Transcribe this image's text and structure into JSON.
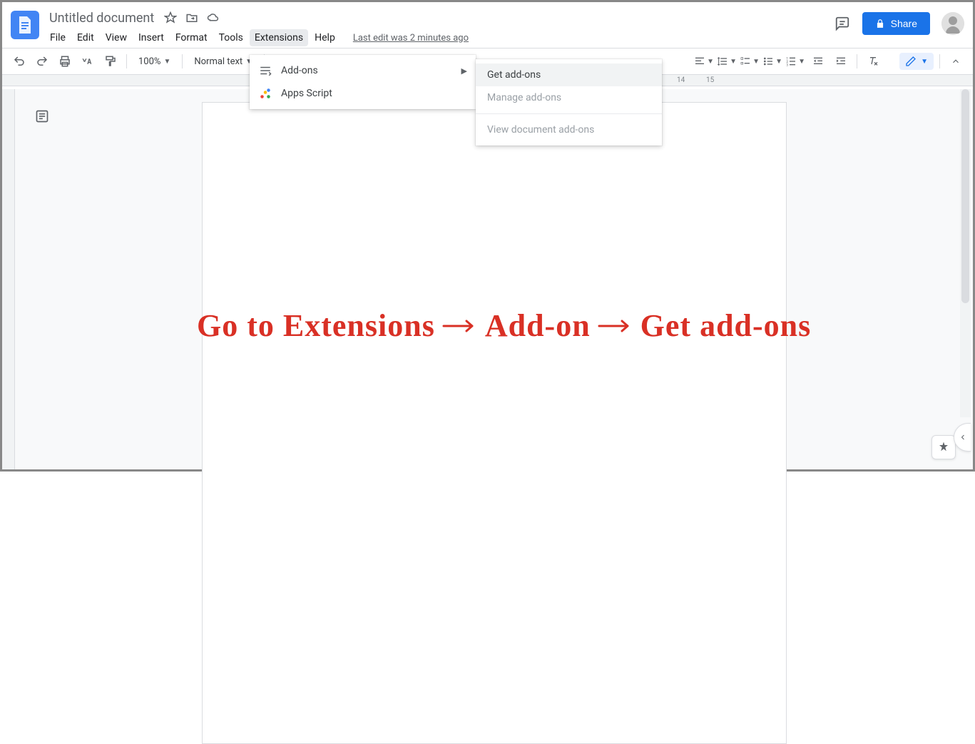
{
  "doc_title": "Untitled document",
  "menus": [
    "File",
    "Edit",
    "View",
    "Insert",
    "Format",
    "Tools",
    "Extensions",
    "Help"
  ],
  "active_menu": "Extensions",
  "last_edit": "Last edit was 2 minutes ago",
  "share_label": "Share",
  "toolbar": {
    "zoom": "100%",
    "style": "Normal text"
  },
  "ruler_marks": [
    "14",
    "15"
  ],
  "dropdown": {
    "items": [
      {
        "label": "Add-ons",
        "has_submenu": true
      },
      {
        "label": "Apps Script",
        "has_submenu": false
      }
    ]
  },
  "submenu": {
    "items": [
      {
        "label": "Get add-ons",
        "state": "highlighted"
      },
      {
        "label": "Manage add-ons",
        "state": "disabled"
      },
      {
        "label": "View document add-ons",
        "state": "disabled",
        "separator_before": true
      }
    ]
  },
  "annotation": {
    "parts": [
      "Go to Extensions",
      "Add-on",
      "Get add-ons"
    ]
  }
}
